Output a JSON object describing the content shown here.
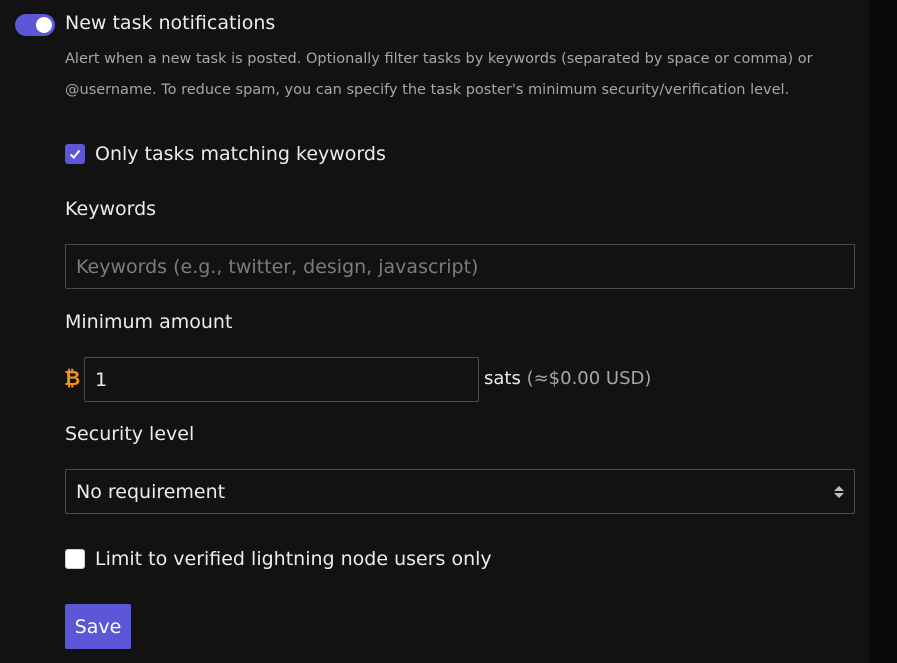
{
  "notifications": {
    "enabled": true,
    "title": "New task notifications",
    "description": "Alert when a new task is posted. Optionally filter tasks by keywords (separated by space or comma) or @username. To reduce spam, you can specify the task poster's minimum security/verification level."
  },
  "keyword_filter": {
    "checked": true,
    "label": "Only tasks matching keywords"
  },
  "keywords": {
    "label": "Keywords",
    "value": "",
    "placeholder": "Keywords (e.g., twitter, design, javascript)"
  },
  "minimum_amount": {
    "label": "Minimum amount",
    "currency_symbol": "₿",
    "value": "1",
    "unit": "sats",
    "usd_equivalent": "(≈$0.00 USD)"
  },
  "security_level": {
    "label": "Security level",
    "selected": "No requirement"
  },
  "verified_lightning": {
    "checked": false,
    "label": "Limit to verified lightning node users only"
  },
  "save_label": "Save",
  "colors": {
    "accent": "#5b57d6",
    "bitcoin": "#f7931a",
    "background": "#121212"
  },
  "icons": {
    "toggle": "toggle-switch-icon",
    "check": "checkmark-icon",
    "currency": "bitcoin-icon",
    "select_arrows": "up-down-chevron-icon"
  }
}
